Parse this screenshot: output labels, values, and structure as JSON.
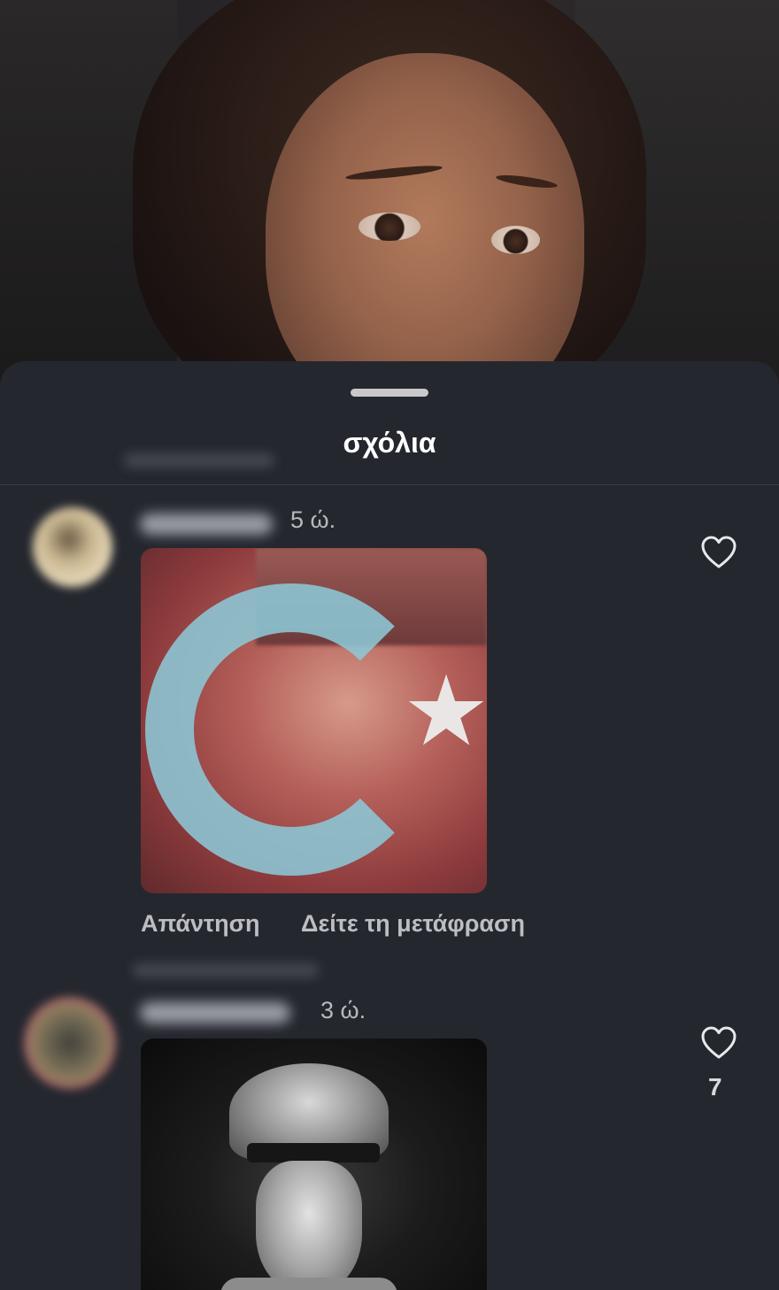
{
  "sheet": {
    "title": "σχόλια"
  },
  "comments": [
    {
      "time": "5 ώ.",
      "reply_label": "Απάντηση",
      "translate_label": "Δείτε τη μετάφραση",
      "likes": ""
    },
    {
      "time": "3 ώ.",
      "likes": "7"
    }
  ],
  "icons": {
    "like": "heart-outline-icon"
  },
  "colors": {
    "sheet_bg": "#25272f",
    "text_primary": "#ffffff",
    "text_secondary": "#b8b9bf"
  }
}
